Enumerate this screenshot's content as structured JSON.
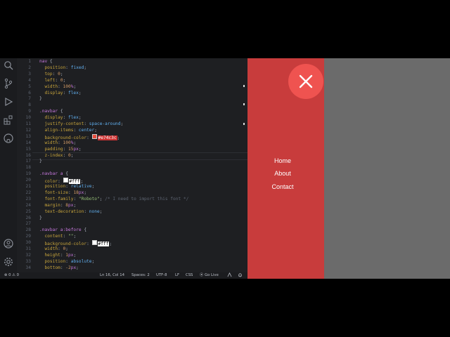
{
  "editor": {
    "lines": [
      {
        "n": "1",
        "t": "nav {"
      },
      {
        "n": "2",
        "t": "  position: fixed;"
      },
      {
        "n": "3",
        "t": "  top: 0;"
      },
      {
        "n": "4",
        "t": "  left: 0;"
      },
      {
        "n": "5",
        "t": "  width: 100%;"
      },
      {
        "n": "6",
        "t": "  display: flex;"
      },
      {
        "n": "7",
        "t": "}"
      },
      {
        "n": "8",
        "t": ""
      },
      {
        "n": "9",
        "t": ".navbar {"
      },
      {
        "n": "10",
        "t": "  display: flex;"
      },
      {
        "n": "11",
        "t": "  justify-content: space-around;"
      },
      {
        "n": "12",
        "t": "  align-items: center;"
      },
      {
        "n": "13",
        "t": "  background-color: #e74c3c;"
      },
      {
        "n": "14",
        "t": "  width: 100%;"
      },
      {
        "n": "15",
        "t": "  padding: 15px;"
      },
      {
        "n": "16",
        "t": "  z-index: 0;"
      },
      {
        "n": "17",
        "t": "}"
      },
      {
        "n": "18",
        "t": ""
      },
      {
        "n": "19",
        "t": ".navbar a {"
      },
      {
        "n": "20",
        "t": "  color: #fff;"
      },
      {
        "n": "21",
        "t": "  position: relative;"
      },
      {
        "n": "22",
        "t": "  font-size: 18px;"
      },
      {
        "n": "23",
        "t": "  font-family: \"Roboto\"; /* I need to import this font */"
      },
      {
        "n": "24",
        "t": "  margin: 8px;"
      },
      {
        "n": "25",
        "t": "  text-decoration: none;"
      },
      {
        "n": "26",
        "t": "}"
      },
      {
        "n": "27",
        "t": ""
      },
      {
        "n": "28",
        "t": ".navbar a:before {"
      },
      {
        "n": "29",
        "t": "  content: \"\";"
      },
      {
        "n": "30",
        "t": "  background-color: #fff;"
      },
      {
        "n": "31",
        "t": "  width: 0;"
      },
      {
        "n": "32",
        "t": "  height: 1px;"
      },
      {
        "n": "33",
        "t": "  position: absolute;"
      },
      {
        "n": "34",
        "t": "  bottom: -2px;"
      }
    ]
  },
  "status_bar": {
    "problems": "⊗ 0 ⚠ 0",
    "position": "Ln 16, Col 14",
    "spaces": "Spaces: 2",
    "encoding": "UTF-8",
    "eol": "LF",
    "language": "CSS",
    "golive": "⦿ Go Live"
  },
  "preview": {
    "close_label": "×",
    "links": [
      "Home",
      "About",
      "Contact"
    ]
  },
  "colors": {
    "menu_bg": "#c83c3c",
    "close_bg": "#ef5350",
    "preview_bg": "#6b6b6b",
    "editor_bg": "#1e1f22"
  }
}
